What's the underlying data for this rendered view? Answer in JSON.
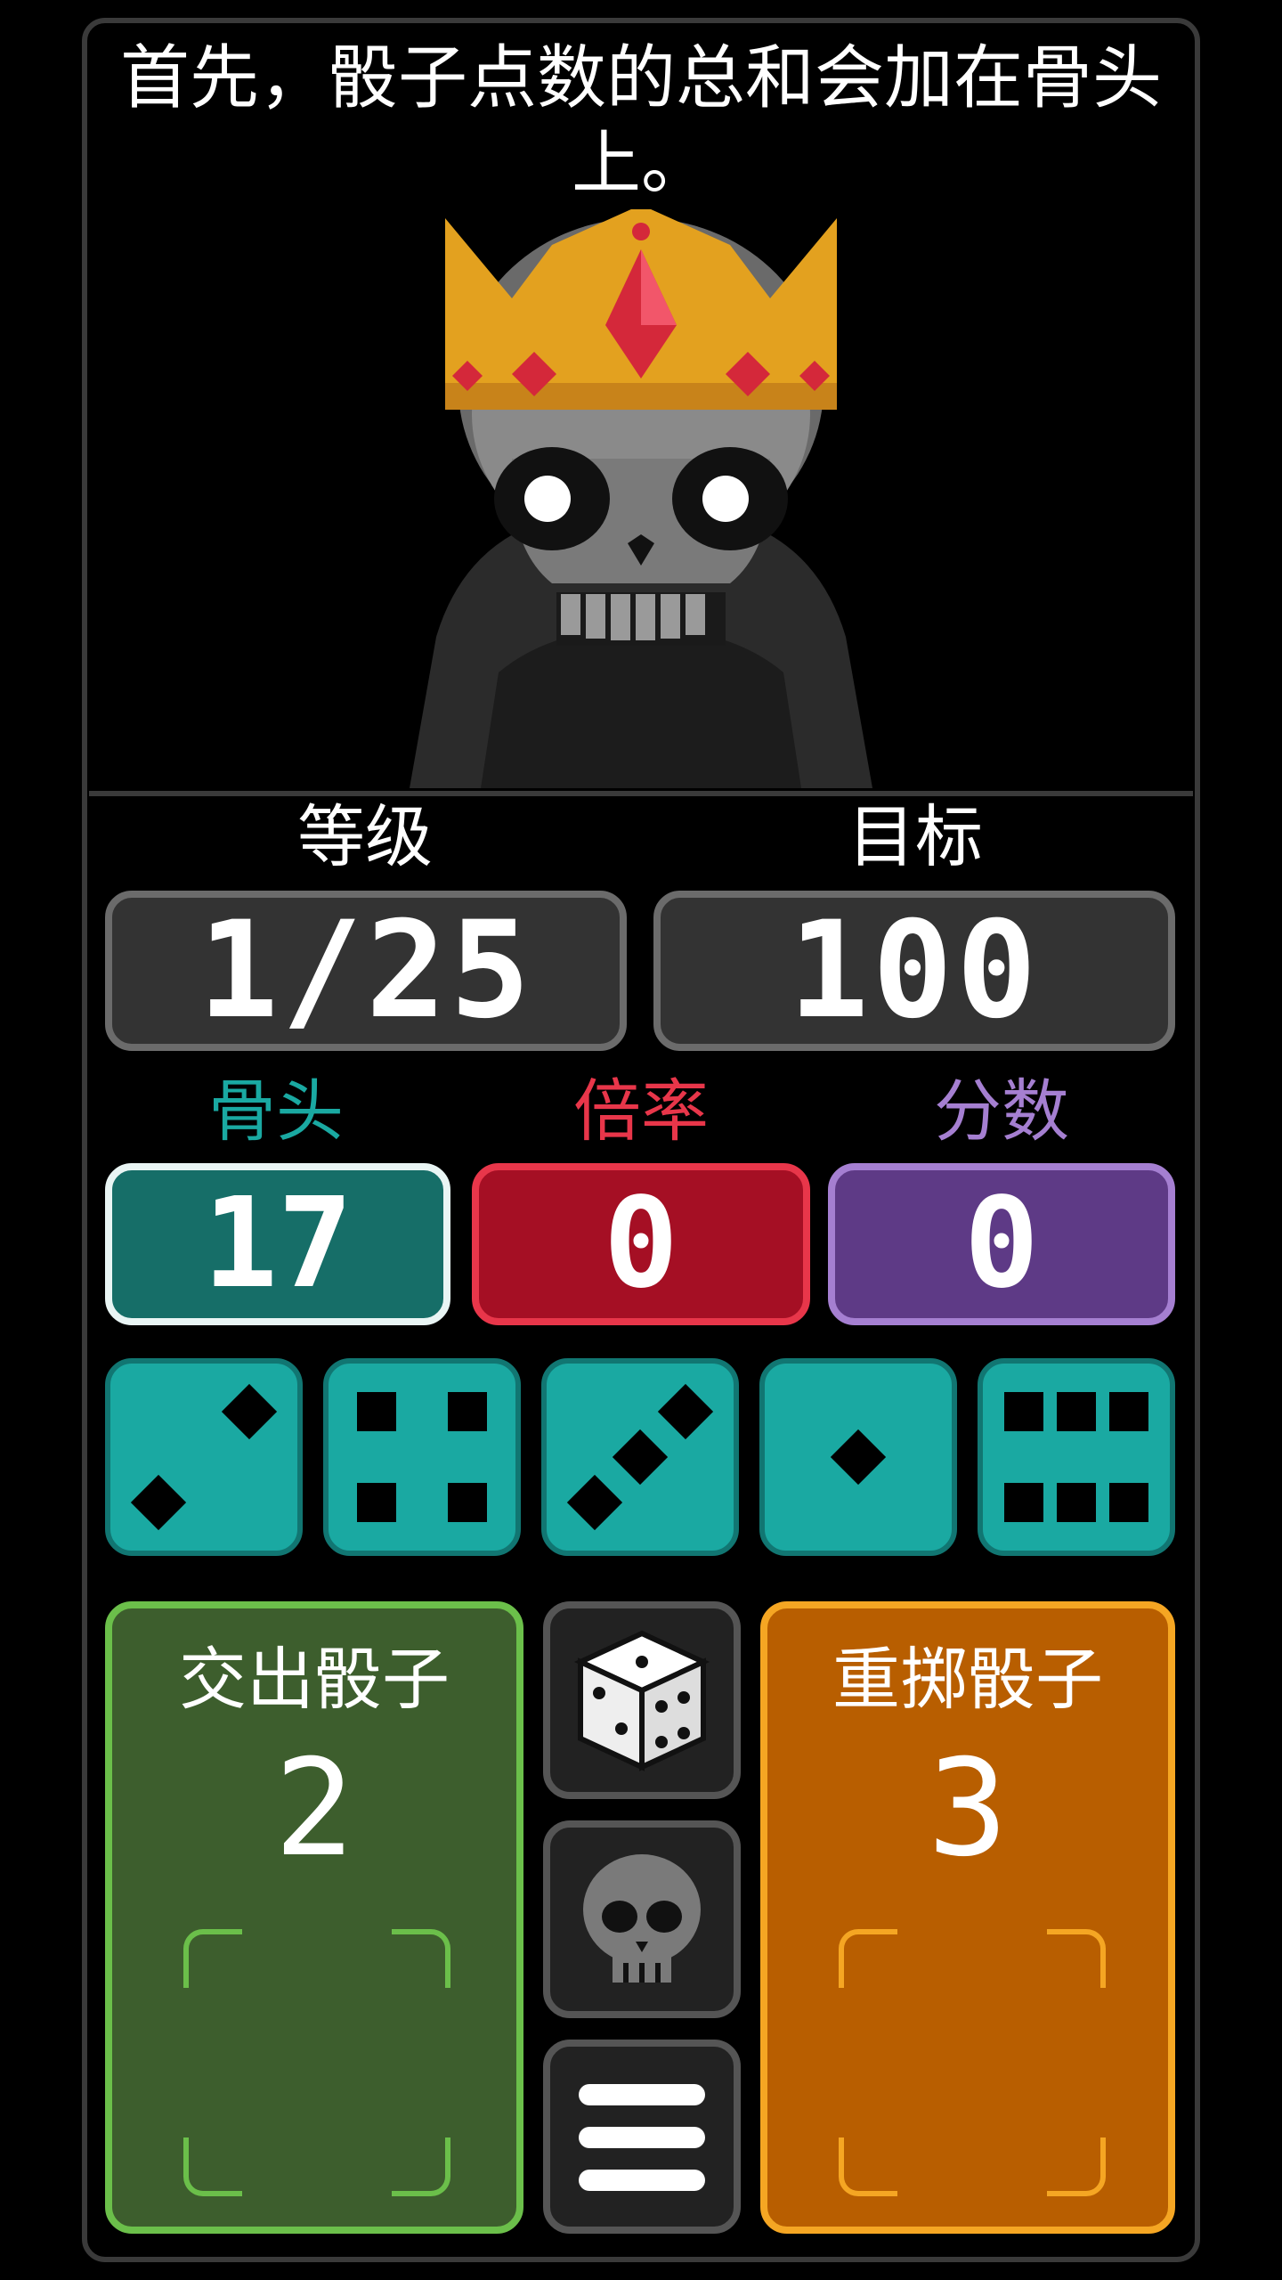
{
  "hint_text": "首先，骰子点数的总和会加在骨头上。",
  "stats": {
    "level_label": "等级",
    "level_value": "1/25",
    "target_label": "目标",
    "target_value": "100"
  },
  "score": {
    "bones_label": "骨头",
    "bones_value": "17",
    "mult_label": "倍率",
    "mult_value": "0",
    "points_label": "分数",
    "points_value": "0"
  },
  "dice": [
    2,
    4,
    3,
    1,
    6
  ],
  "actions": {
    "submit_label": "交出骰子",
    "submit_count": "2",
    "reroll_label": "重掷骰子",
    "reroll_count": "3"
  },
  "icons": {
    "dice_button": "dice-icon",
    "skull_button": "skull-icon",
    "menu_button": "menu-icon"
  },
  "colors": {
    "bones": "#1aa9a2",
    "mult": "#e8364a",
    "points": "#a57fd1",
    "submit": "#3d5e2d",
    "reroll": "#b85e00"
  }
}
